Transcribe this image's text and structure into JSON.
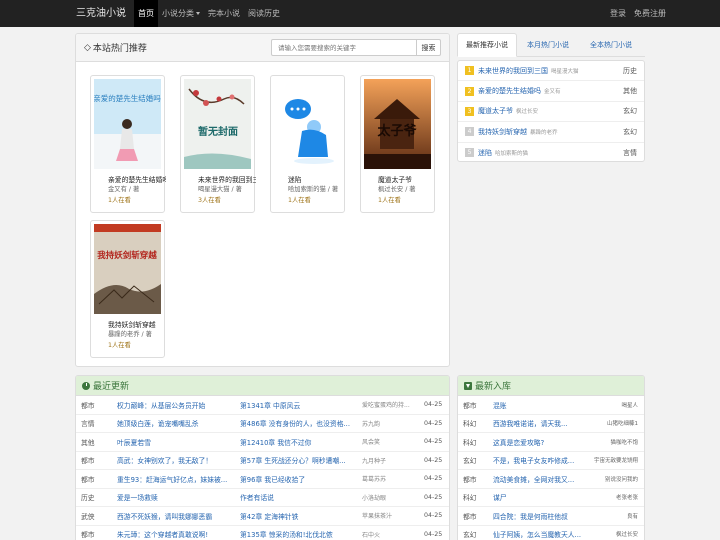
{
  "nav": {
    "brand": "三克油小说",
    "items": [
      {
        "label": "首页",
        "active": true
      },
      {
        "label": "小说分类",
        "dropdown": true
      },
      {
        "label": "完本小说"
      },
      {
        "label": "阅读历史"
      }
    ],
    "login": "登录",
    "register": "免费注册"
  },
  "hot": {
    "title": "本站热门推荐",
    "search_placeholder": "请输入您需要搜索的关键字",
    "search_button": "搜索",
    "books": [
      {
        "title": "亲爱的楚先生结婚吗",
        "author": "金又有 / 著",
        "readers": "1人在看",
        "cover": "亲爱的楚先生结婚吗"
      },
      {
        "title": "未来世界的我回到三国",
        "author": "喝星漫大猫 / 著",
        "readers": "3人在看",
        "cover": "暂无封面"
      },
      {
        "title": "迷陷",
        "author": "哈加索斯的猫 / 著",
        "readers": "1人在看",
        "cover": ""
      },
      {
        "title": "魔道太子爷",
        "author": "枫过长安 / 著",
        "readers": "1人在看",
        "cover": "太子爷"
      },
      {
        "title": "我持妖剑斩穿越",
        "author": "暴躁的老乔 / 著",
        "readers": "1人在看",
        "cover": "我持妖剑斩穿越"
      }
    ]
  },
  "rank": {
    "tabs": [
      "最新推荐小说",
      "本月热门小说",
      "全本热门小说"
    ],
    "items": [
      {
        "num": "1",
        "title": "未来世界的我回到三国",
        "author": "喝星漫大猫",
        "cat": "历史"
      },
      {
        "num": "2",
        "title": "亲爱的楚先生结婚吗",
        "author": "金又有",
        "cat": "其他"
      },
      {
        "num": "3",
        "title": "魔道太子爷",
        "author": "枫过长安",
        "cat": "玄幻"
      },
      {
        "num": "4",
        "title": "我持妖剑斩穿越",
        "author": "暴躁的老乔",
        "cat": "玄幻"
      },
      {
        "num": "5",
        "title": "迷陷",
        "author": "哈加索斯的猫",
        "cat": "言情"
      }
    ]
  },
  "updates": {
    "title": "最近更新",
    "rows": [
      {
        "cat": "都市",
        "title": "权力巅峰：从基层公务员开始",
        "chapter": "第1341章 中原风云",
        "author": "爱吃蜜蛋鸡的持...",
        "date": "04-25"
      },
      {
        "cat": "言情",
        "title": "她顶级白莲，诡宠嘴嘴乱杀",
        "chapter": "第486章 没有身份的人，也没资格...",
        "author": "苏九韵",
        "date": "04-25"
      },
      {
        "cat": "其他",
        "title": "叶辰夏若雪",
        "chapter": "第12410章 我信不过你",
        "author": "风会笑",
        "date": "04-25"
      },
      {
        "cat": "都市",
        "title": "高武：女神别欢了，我无敌了！",
        "chapter": "第57章 生死战还分心？啊秒遭嘲...",
        "author": "九月种子",
        "date": "04-25"
      },
      {
        "cat": "都市",
        "title": "重生93：赶海运气好亿点，妹妹被...",
        "chapter": "第96章 我已经收拾了",
        "author": "葛葛苏苏",
        "date": "04-25"
      },
      {
        "cat": "历史",
        "title": "爱是一场救赎",
        "chapter": "作者有话说",
        "author": "小洛劫眼",
        "date": "04-25"
      },
      {
        "cat": "武侠",
        "title": "西游不死妖猴，请叫我娜娜恶霸",
        "chapter": "第42章 定海神针铁",
        "author": "苹果抹茶汁",
        "date": "04-25"
      },
      {
        "cat": "都市",
        "title": "朱元璋：这个穿越者真敢说啊!",
        "chapter": "第135章 惊采的汤和!北伐北侬",
        "author": "石中火",
        "date": "04-25"
      }
    ]
  },
  "newbooks": {
    "title": "最新入库",
    "rows": [
      {
        "cat": "都市",
        "title": "混账",
        "author": "喝星人"
      },
      {
        "cat": "科幻",
        "title": "西游我唯诺诺，请天我...",
        "author": "山猪吃细糠1"
      },
      {
        "cat": "科幻",
        "title": "这真是恋爱攻略?",
        "author": "猫咖吃不饱"
      },
      {
        "cat": "玄幻",
        "title": "不是，我电子女友咋修成...",
        "author": "宇宙无敌要龙饶翔"
      },
      {
        "cat": "都市",
        "title": "流动美食摊，全网对我又...",
        "author": "别说没问我的"
      },
      {
        "cat": "科幻",
        "title": "谋尸",
        "author": "老张老张"
      },
      {
        "cat": "都市",
        "title": "四合院：我是何雨柱他叔",
        "author": "良有"
      },
      {
        "cat": "玄幻",
        "title": "仙子阿姨，怎么当魔教天人...",
        "author": "枫过长安"
      }
    ]
  }
}
